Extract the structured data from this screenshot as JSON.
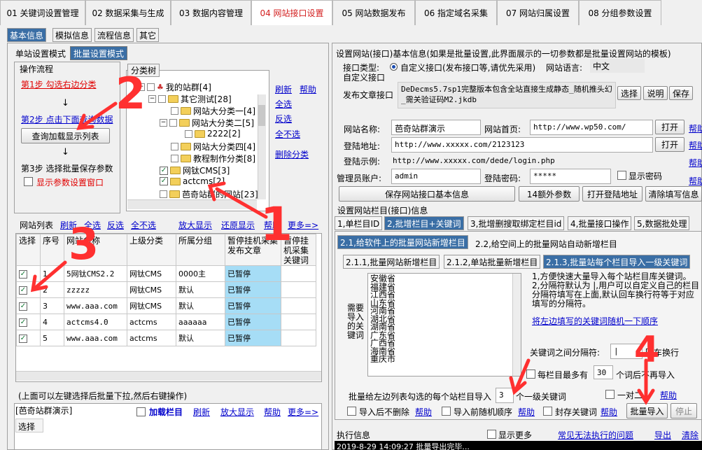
{
  "top_tabs": [
    "01 关键词设置管理",
    "02 数据采集与生成",
    "03 数据内容管理",
    "04 网站接口设置",
    "05 网站数据发布",
    "06 指定域名采集",
    "07 网站归属设置",
    "08 分组参数设置"
  ],
  "sub_tabs": [
    "基本信息",
    "模拟信息",
    "流程信息",
    "其它"
  ],
  "mode_tabs": [
    "单站设置模式",
    "批量设置模式"
  ],
  "flow": {
    "title": "操作流程",
    "step1": "第1步 勾选右边分类",
    "step2": "第2步 点击下面查询数据",
    "load_btn": "查询加载显示列表",
    "step3": "第3步 选择批量保存参数",
    "show_params": "显示参数设置窗口"
  },
  "category_tree": {
    "title": "分类树",
    "nodes": [
      "我的站群[4]",
      "其它测试[28]",
      "网站大分类一[4]",
      "网站大分类二[5]",
      "2222[2]",
      "网站大分类四[4]",
      "教程制作分类[8]",
      "网钛CMS[3]",
      "actcms[2]",
      "芭奇站群的网站[23]"
    ]
  },
  "tree_links": [
    "刷新",
    "帮助",
    "全选",
    "反选",
    "全不选",
    "删除分类"
  ],
  "site_list": {
    "title": "网站列表",
    "links": [
      "刷新",
      "全选",
      "反选",
      "全不选"
    ],
    "links2": [
      "放大显示",
      "还原显示",
      "帮助",
      "更多=>"
    ],
    "columns": [
      "选择",
      "序号",
      "网站名称",
      "上级分类",
      "所属分组",
      "暂停挂机采集发布文章",
      "暂停挂机采集关键词"
    ],
    "rows": [
      [
        "1",
        "5网钛CMS2.2",
        "网钛CMS",
        "0000主",
        "已暂停"
      ],
      [
        "2",
        "zzzzz",
        "网钛CMS",
        "默认",
        "已暂停"
      ],
      [
        "3",
        "www.aaa.com",
        "网钛CMS",
        "默认",
        "已暂停"
      ],
      [
        "4",
        "actcms4.0",
        "actcms",
        "aaaaaa",
        "已暂停"
      ],
      [
        "5",
        "www.aaa.com",
        "actcms",
        "默认",
        "已暂停"
      ]
    ],
    "note": "(上面可以左键选择后批量下拉,然后右键操作)"
  },
  "column_panel": {
    "title": "[芭奇站群演示]",
    "load_col": "加载栏目",
    "links": [
      "刷新",
      "放大显示",
      "帮助",
      "更多=>"
    ],
    "col_header": "选择"
  },
  "right": {
    "header": "设置网站(接口)基本信息(如果是批量设置,此界面展示的一切参数都是批量设置网站的模板)",
    "iface_type_label": "接口类型:",
    "iface_option": "自定义接口(发布接口等,请优先采用)",
    "lang_label": "网站语言:",
    "lang_value": "中文",
    "custom_iface": "自定义接口",
    "publish_label": "发布文章接口",
    "publish_value": "DeDecms5.7sp1完整版本包含全站直接生成静态_随机推头幻_需关验证码M2.jkdb",
    "btn_select": "选择",
    "btn_explain": "说明",
    "btn_save": "保存",
    "site_name_label": "网站名称:",
    "site_name": "芭奇站群演示",
    "home_label": "网站首页:",
    "home_url": "http://www.wp50.com/",
    "open": "打开",
    "help": "帮助",
    "login_label": "登陆地址:",
    "login_url": "http://www.xxxxx.com/2123123",
    "login_example_label": "登陆示例:",
    "login_example": "http://www.xxxxx.com/dede/login.php",
    "admin_label": "管理员账户:",
    "admin_value": "admin",
    "pwd_label": "登陆密码:",
    "pwd_value": "*****",
    "show_pwd": "显示密码",
    "btn_save_iface": "保存网站接口基本信息",
    "btn_14": "14额外参数",
    "btn_open_login": "打开登陆地址",
    "btn_clear": "清除填写信息",
    "col_header": "设置网站栏目(接口)信息",
    "col_tabs": [
      "1,单栏目ID",
      "2,批增栏目+关键词",
      "3,批增删搜取绑定栏目id",
      "4,批量接口操作",
      "5,数据批处理"
    ],
    "col_sub": [
      "2.1,给软件上的批量网站新增栏目",
      "2.2,给空间上的批量网站自动新增栏目"
    ],
    "col_sub2": [
      "2.1.1,批量网站新增栏目",
      "2.1.2,单站批量新增栏目",
      "2.1.3,批量站每个栏目导入一级关键词"
    ],
    "kw_label": "需要导入的关键词",
    "provinces": [
      "安徽省",
      "福建省",
      "江西省",
      "山东省",
      "河南省",
      "湖北省",
      "湖南省",
      "广东省",
      "广西省",
      "海南省",
      "重庆市"
    ],
    "tips": "1,方便快速大量导入每个站栏目库关键词。\n2,分隔符默认为 |,用户可以自定义自己的栏目分隔符填写在上面,默认回车换行符等于对应填写的分隔符。",
    "tip_link": "将左边填写的关键词随机一下顺序",
    "sep_label": "关键词之间分隔符:",
    "sep_value": "|",
    "enter_label": "回车换行",
    "max_label": "每栏目最多有",
    "max_value": "30",
    "max_suffix": "个词后不再导入",
    "import_label": "批量给左边列表勾选的每个站栏目导入",
    "import_value": "3",
    "import_suffix": "个一级关键词",
    "one_to_one": "一对二",
    "no_del": "导入后不删除",
    "random_order": "导入前随机顺序",
    "lock_kw": "封存关键词",
    "btn_import": "批量导入",
    "btn_stop": "停止",
    "exec_title": "执行信息",
    "show_more": "显示更多",
    "cant_exec": "常见无法执行的问题",
    "export": "导出",
    "clear": "清除",
    "log": "2019-8-29 14:09:27  批量导出完毕..."
  },
  "annotations": [
    "2",
    "3",
    "1",
    "4"
  ]
}
